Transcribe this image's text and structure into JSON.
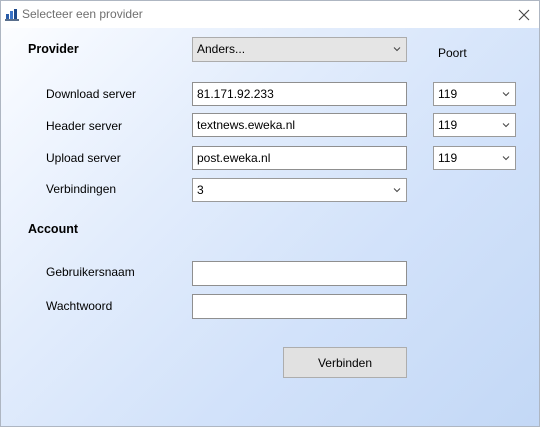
{
  "window": {
    "title": "Selecteer een provider"
  },
  "provider": {
    "section_label": "Provider",
    "selected": "Anders...",
    "port_header": "Poort"
  },
  "servers": {
    "download": {
      "label": "Download server",
      "value": "81.171.92.233",
      "port": "119"
    },
    "header": {
      "label": "Header server",
      "value": "textnews.eweka.nl",
      "port": "119"
    },
    "upload": {
      "label": "Upload server",
      "value": "post.eweka.nl",
      "port": "119"
    },
    "connections": {
      "label": "Verbindingen",
      "value": "3"
    }
  },
  "account": {
    "section_label": "Account",
    "username": {
      "label": "Gebruikersnaam",
      "value": ""
    },
    "password": {
      "label": "Wachtwoord",
      "value": ""
    }
  },
  "actions": {
    "connect_label": "Verbinden"
  }
}
